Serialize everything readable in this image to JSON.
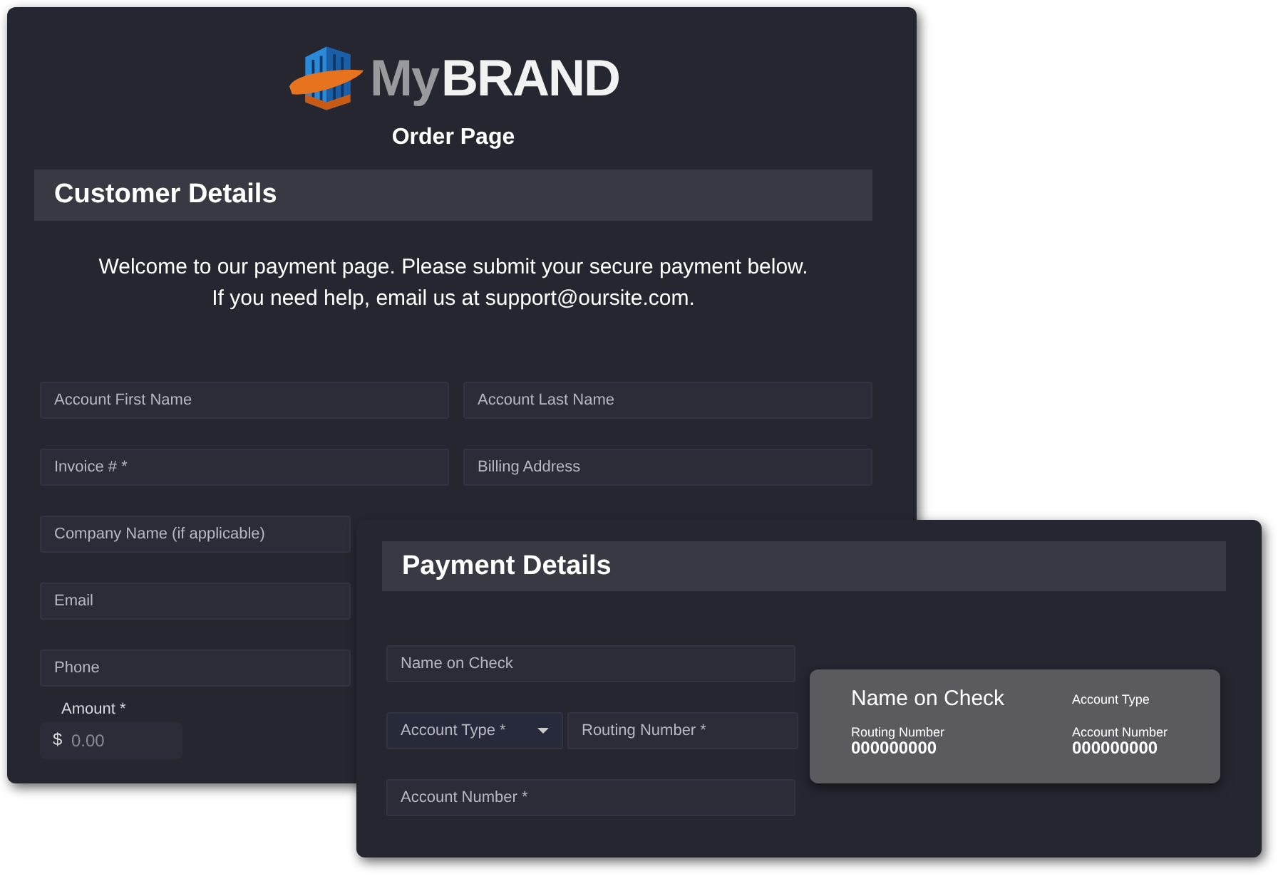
{
  "brand": {
    "prefix": "My",
    "name": "BRAND"
  },
  "page_title": "Order Page",
  "customer": {
    "heading": "Customer Details",
    "intro": [
      "Welcome to our payment page. Please submit your secure payment below.",
      "If you need help, email us at support@oursite.com."
    ],
    "rows": [
      [
        {
          "placeholder": "Account First Name"
        },
        {
          "placeholder": "Account Last Name"
        }
      ],
      [
        {
          "placeholder": "Invoice # *"
        },
        {
          "placeholder": "Billing Address"
        }
      ],
      [
        {
          "placeholder": "Company Name (if applicable)"
        }
      ],
      [
        {
          "placeholder": "Email"
        }
      ],
      [
        {
          "placeholder": "Phone"
        }
      ]
    ],
    "amount": {
      "label": "Amount *",
      "currency": "$",
      "placeholder": "0.00"
    }
  },
  "payment": {
    "heading": "Payment Details",
    "rows": [
      [
        {
          "kind": "text",
          "placeholder": "Name on Check"
        }
      ],
      [
        {
          "kind": "select",
          "placeholder": "Account Type *"
        },
        {
          "kind": "text",
          "placeholder": "Routing Number *"
        }
      ],
      [
        {
          "kind": "text",
          "placeholder": "Account Number *"
        }
      ]
    ],
    "check_preview": {
      "name": "Name on Check",
      "account_type": "Account Type",
      "routing_label": "Routing Number",
      "routing_value": "000000000",
      "account_label": "Account Number",
      "account_value": "000000000"
    }
  }
}
